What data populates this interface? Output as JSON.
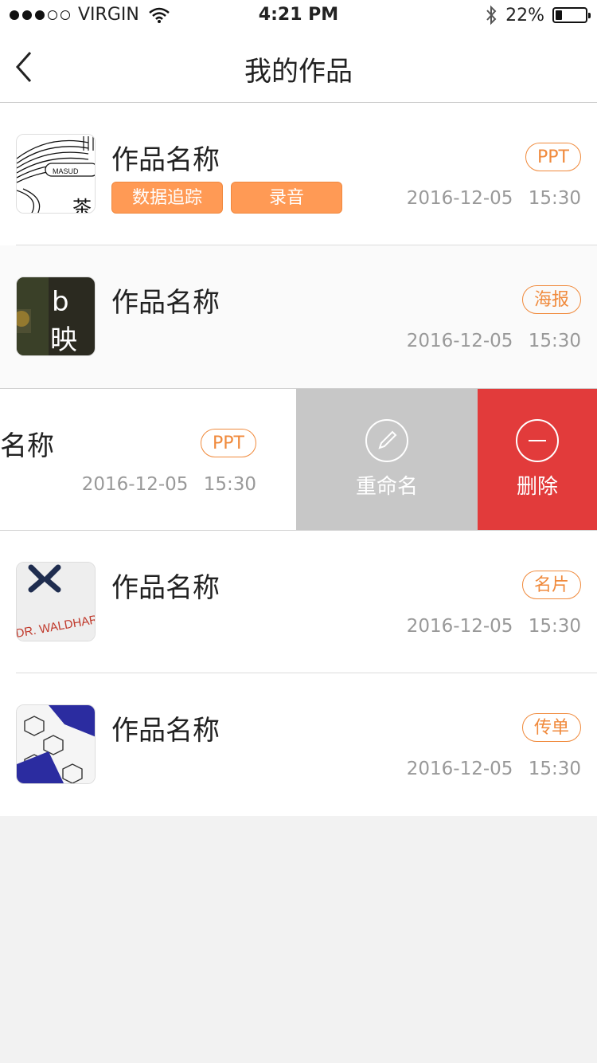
{
  "status": {
    "carrier": "VIRGIN",
    "time": "4:21 PM",
    "battery": "22%",
    "battery_level": 0.22
  },
  "nav": {
    "title": "我的作品"
  },
  "items": [
    {
      "name": "作品名称",
      "tag": "PPT",
      "date": "2016-12-05  15:30",
      "badges": [
        "数据追踪",
        "录音"
      ]
    },
    {
      "name": "作品名称",
      "tag": "海报",
      "date": "2016-12-05  15:30"
    },
    {
      "name": "名称",
      "tag": "PPT",
      "date": "2016-12-05  15:30"
    },
    {
      "name": "作品名称",
      "tag": "名片",
      "date": "2016-12-05  15:30"
    },
    {
      "name": "作品名称",
      "tag": "传单",
      "date": "2016-12-05  15:30"
    }
  ],
  "actions": {
    "rename": "重命名",
    "delete": "删除"
  },
  "colors": {
    "accent": "#f08a3c",
    "badge": "#ff9a55",
    "delete": "#e23b3b",
    "rename": "#c7c7c7"
  }
}
